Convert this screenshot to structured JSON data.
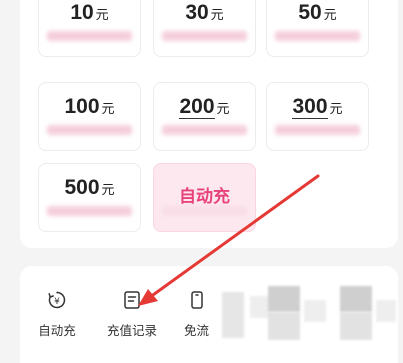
{
  "recharge_options": {
    "unit": "元",
    "tiles": [
      {
        "amount": "10"
      },
      {
        "amount": "30"
      },
      {
        "amount": "50"
      },
      {
        "amount": "100"
      },
      {
        "amount": "200"
      },
      {
        "amount": "300"
      },
      {
        "amount": "500"
      }
    ],
    "auto_recharge_tile": "自动充"
  },
  "actions": {
    "auto_recharge": "自动充",
    "recharge_history": "充值记录",
    "partial_third": "免流"
  },
  "colors": {
    "accent_pink": "#e8427a",
    "annotation_arrow": "#e53935"
  },
  "icons": {
    "auto_recharge": "yen-cycle-icon",
    "recharge_history": "document-list-icon",
    "free_data": "phone-icon"
  }
}
